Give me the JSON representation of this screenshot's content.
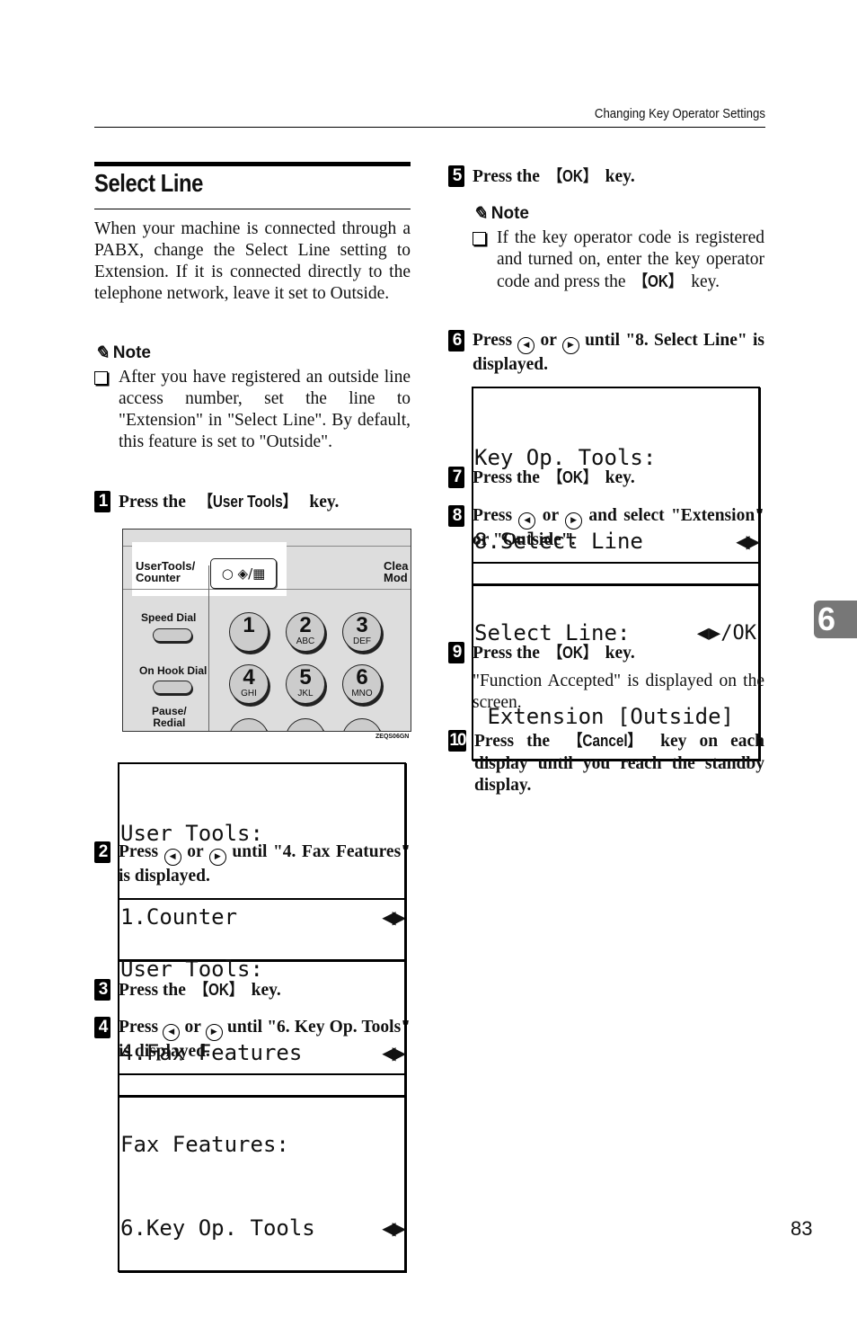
{
  "header": {
    "title": "Changing Key Operator Settings"
  },
  "section": {
    "title": "Select Line",
    "intro": "When your machine is connected through a PABX, change the Select Line setting to Extension. If it is connected directly to the telephone network, leave it set to Outside.",
    "note_label": "Note",
    "note_text": "After you have registered an outside line access number, set the line to \"Extension\" in \"Select Line\". By default, this feature is set to \"Outside\"."
  },
  "steps": [
    {
      "num": "1",
      "pre": "Press the ",
      "key": "【User Tools】",
      "post": " key."
    },
    {
      "num": "2",
      "pre": "Press ",
      "mid": " or ",
      "post": " until \"4. Fax Features\" is displayed."
    },
    {
      "num": "3",
      "pre": "Press the ",
      "key": "【OK】",
      "post": " key."
    },
    {
      "num": "4",
      "pre": "Press ",
      "mid": " or ",
      "post": " until \"6. Key Op. Tools\" is displayed."
    },
    {
      "num": "5",
      "pre": "Press the ",
      "key": "【OK】",
      "post": " key.",
      "note_label": "Note",
      "note_text_pre": "If the key operator code is registered and turned on, enter the key operator code and press the ",
      "note_key": "【OK】",
      "note_text_post": " key."
    },
    {
      "num": "6",
      "pre": "Press ",
      "mid": " or ",
      "post": " until \"8. Select Line\" is displayed."
    },
    {
      "num": "7",
      "pre": "Press the ",
      "key": "【OK】",
      "post": " key."
    },
    {
      "num": "8",
      "pre": "Press ",
      "mid": " or ",
      "post": " and select \"Extension\" or \"Outside\"."
    },
    {
      "num": "9",
      "pre": "Press the ",
      "key": "【OK】",
      "post": " key.",
      "detail": "\"Function Accepted\" is displayed on the screen."
    },
    {
      "num": "10",
      "pre": "Press the ",
      "key": "【Cancel】",
      "post": " key on each display until you reach the standby display."
    }
  ],
  "icons": {
    "left": "◀",
    "right": "▶",
    "lcd_arrows": "◀▶"
  },
  "lcd": {
    "counter": [
      "User Tools:",
      "1.Counter"
    ],
    "fax_features": [
      "User Tools:",
      "4.Fax Features"
    ],
    "key_op": [
      "Fax Features:",
      "6.Key Op. Tools"
    ],
    "select_line_menu": [
      "Key Op. Tools:",
      "8.Select Line"
    ],
    "select_line_setting": [
      "Select Line:",
      " Extension [Outside]"
    ],
    "setting_hint": "◀▶/OK"
  },
  "panel": {
    "usertools_label": "UserTools/\nCounter",
    "usertools_key": "○ ◈/▦",
    "clear_label": "Clea\nMod",
    "speed_dial": "Speed Dial",
    "on_hook_dial": "On Hook Dial",
    "pause_redial": "Pause/\nRedial",
    "keys": [
      {
        "d": "1",
        "l": ""
      },
      {
        "d": "2",
        "l": "ABC"
      },
      {
        "d": "3",
        "l": "DEF"
      },
      {
        "d": "4",
        "l": "GHI"
      },
      {
        "d": "5",
        "l": "JKL"
      },
      {
        "d": "6",
        "l": "MNO"
      }
    ],
    "figure_id": "ZEQS06GN"
  },
  "chapter_tab": "6",
  "page_number": "83"
}
